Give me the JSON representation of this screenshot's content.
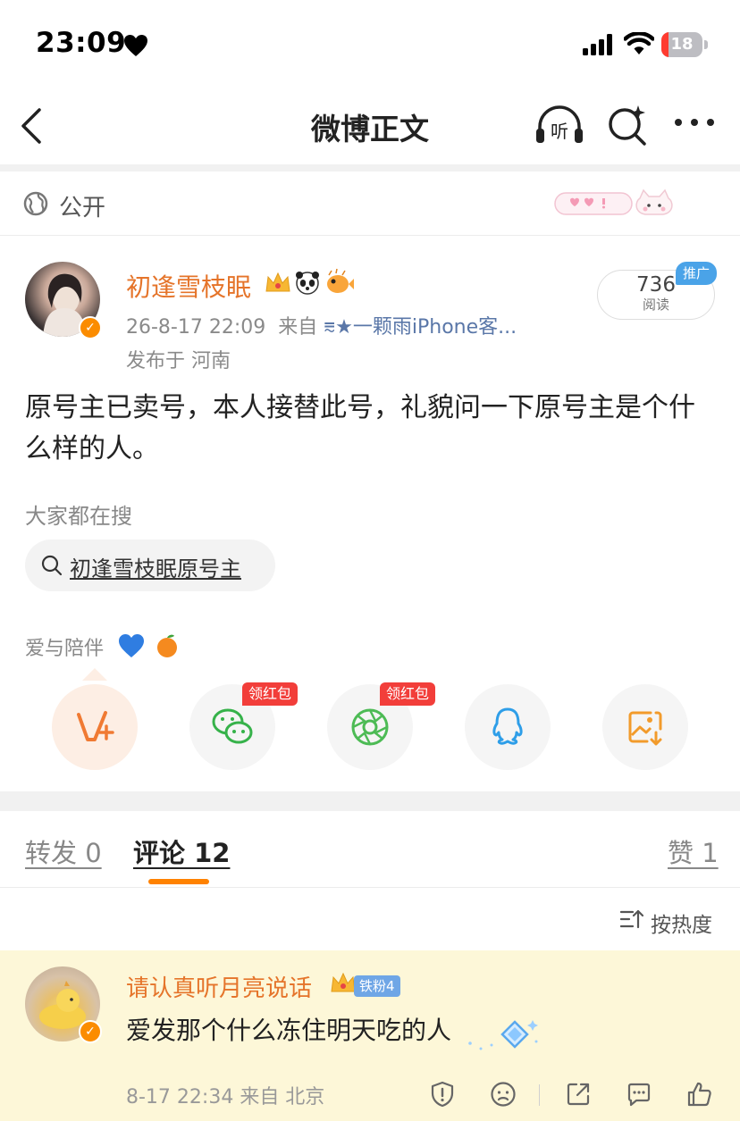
{
  "status_bar": {
    "time": "23:09",
    "battery": "18",
    "battery_level": 0.18
  },
  "nav": {
    "title": "微博正文",
    "listen_label": "听"
  },
  "visibility": {
    "label": "公开"
  },
  "post": {
    "author": "初逢雪枝眠",
    "timestamp": "26-8-17 22:09",
    "source_prefix": "来自",
    "source": "⩳★一颗雨iPhone客...",
    "location": "发布于 河南",
    "reads": "736",
    "reads_label": "阅读",
    "promo_tag": "推广",
    "body": "原号主已卖号，本人接替此号，礼貌问一下原号主是个什么样的人。"
  },
  "hot_search": {
    "label": "大家都在搜",
    "query": "初逢雪枝眠原号主"
  },
  "topic": {
    "label": "爱与陪伴"
  },
  "share": {
    "redpack_label": "领红包"
  },
  "tabs": {
    "repost": "转发 0",
    "comments": "评论 12",
    "likes": "赞 1"
  },
  "sort": {
    "label": "按热度"
  },
  "comment": {
    "author": "请认真听月亮说话",
    "fan_badge": "铁粉4",
    "text": "爱发那个什么冻住明天吃的人",
    "meta": "8-17 22:34 来自 北京"
  },
  "colors": {
    "accent": "#ff8200",
    "name": "#e5742a",
    "link": "#5a77a8",
    "highlight_bg": "#fdf7d8"
  }
}
